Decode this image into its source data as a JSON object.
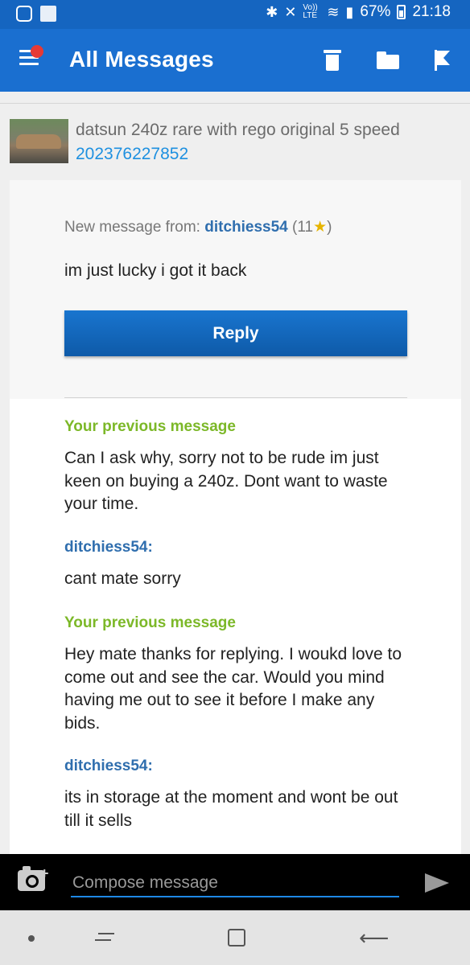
{
  "status_bar": {
    "icons": [
      "instagram-icon",
      "news-icon",
      "bluetooth-icon",
      "mute-icon",
      "volte-icon",
      "wifi-icon",
      "signal-icon",
      "battery-icon"
    ],
    "volte": "Vo)) LTE",
    "battery": "67%",
    "time": "21:18"
  },
  "app_bar": {
    "title": "All Messages",
    "icons": [
      "menu-icon",
      "trash-icon",
      "folder-icon",
      "flag-icon"
    ]
  },
  "listing": {
    "title": "datsun 240z rare with rego original 5 speed",
    "item_id": "202376227852"
  },
  "message": {
    "from_prefix": "New message from:",
    "from_user": "ditchiess54",
    "feedback_open": "(11",
    "star": "★",
    "feedback_close": ")",
    "text": "im just lucky i got it back",
    "reply_label": "Reply"
  },
  "history": [
    {
      "label": "Your previous message",
      "mine": true,
      "text": "Can I ask why, sorry not to be rude im just keen on buying a 240z. Dont want to waste your time."
    },
    {
      "label": "ditchiess54:",
      "mine": false,
      "text": "cant mate sorry"
    },
    {
      "label": "Your previous message",
      "mine": true,
      "text": "Hey mate thanks for replying. I woukd love to come out and see the car. Would you mind having me out to see it before I make any bids."
    },
    {
      "label": "ditchiess54:",
      "mine": false,
      "text": "its in storage at the moment and wont be out till it sells"
    }
  ],
  "compose": {
    "placeholder": "Compose message",
    "camera_plus": "+"
  },
  "nav_bar": {
    "icons": [
      "nav-dot-icon",
      "recents-icon",
      "home-icon",
      "back-icon"
    ],
    "back_glyph": "⟵"
  },
  "colors": {
    "app_bar": "#1a6fd0",
    "accent_blue": "#1e90e0",
    "username": "#2f6eae",
    "mine_label": "#7cb828",
    "notification_dot": "#e53935"
  }
}
